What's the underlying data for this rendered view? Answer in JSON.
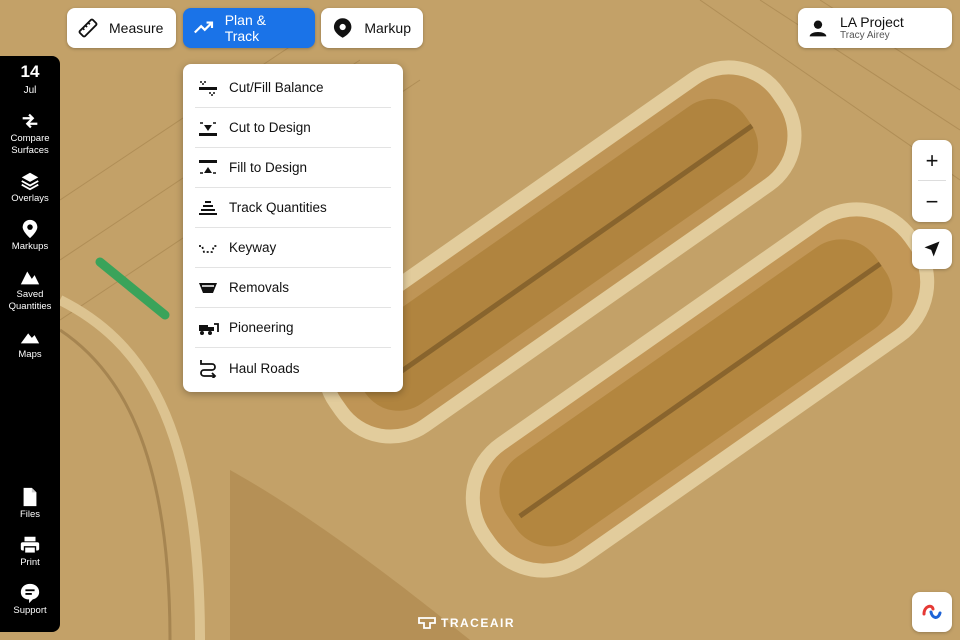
{
  "toolbar": {
    "measure": "Measure",
    "plan_track": "Plan & Track",
    "markup": "Markup"
  },
  "plan_track_menu": [
    {
      "label": "Cut/Fill Balance",
      "icon": "cut-fill-balance-icon"
    },
    {
      "label": "Cut to Design",
      "icon": "cut-to-design-icon"
    },
    {
      "label": "Fill to Design",
      "icon": "fill-to-design-icon"
    },
    {
      "label": "Track Quantities",
      "icon": "track-quantities-icon"
    },
    {
      "label": "Keyway",
      "icon": "keyway-icon"
    },
    {
      "label": "Removals",
      "icon": "removals-icon"
    },
    {
      "label": "Pioneering",
      "icon": "pioneering-icon"
    },
    {
      "label": "Haul Roads",
      "icon": "haul-roads-icon"
    }
  ],
  "sidebar": {
    "date_day": "14",
    "date_month": "Jul",
    "items": [
      {
        "label_line1": "Compare",
        "label_line2": "Surfaces",
        "icon": "compare-arrows-icon"
      },
      {
        "label_line1": "Overlays",
        "label_line2": "",
        "icon": "layers-icon"
      },
      {
        "label_line1": "Markups",
        "label_line2": "",
        "icon": "map-pin-icon"
      },
      {
        "label_line1": "Saved",
        "label_line2": "Quantities",
        "icon": "saved-quantities-icon"
      },
      {
        "label_line1": "Maps",
        "label_line2": "",
        "icon": "mountain-icon"
      }
    ],
    "bottom_items": [
      {
        "label": "Files",
        "icon": "file-icon"
      },
      {
        "label": "Print",
        "icon": "printer-icon"
      },
      {
        "label": "Support",
        "icon": "chat-icon"
      }
    ]
  },
  "project": {
    "name": "LA Project",
    "user": "Tracy Airey"
  },
  "zoom": {
    "in": "+",
    "out": "−"
  },
  "brand": "TRACEAIR",
  "colors": {
    "accent": "#1a73e8",
    "sidebar": "#000000"
  }
}
